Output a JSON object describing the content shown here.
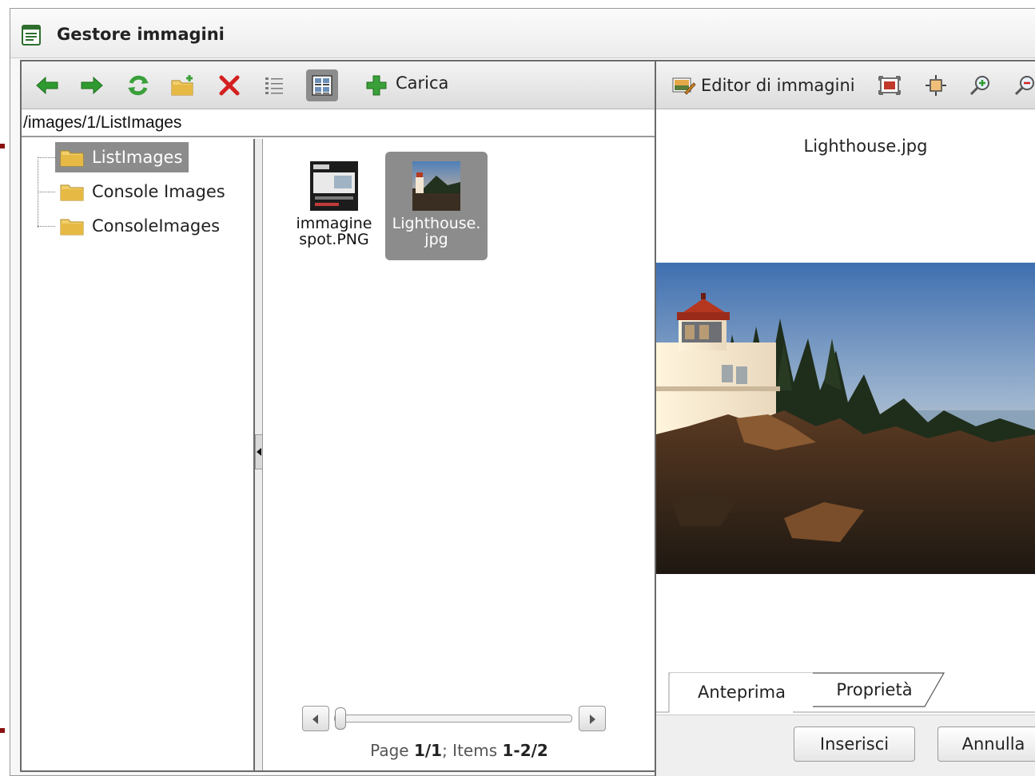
{
  "window": {
    "title": "Gestore immagini"
  },
  "explorer": {
    "toolbar": {
      "buttons": [
        {
          "name": "back",
          "icon": "arrow-left-icon",
          "color": "#2f9a2f"
        },
        {
          "name": "forward",
          "icon": "arrow-right-icon",
          "color": "#2f9a2f"
        },
        {
          "name": "refresh",
          "icon": "refresh-icon",
          "color": "#3aa03a"
        },
        {
          "name": "new-folder",
          "icon": "new-folder-icon",
          "color": "#e0b94a"
        },
        {
          "name": "delete",
          "icon": "delete-icon",
          "color": "#d42020"
        },
        {
          "name": "list-view",
          "icon": "list-view-icon",
          "active": false
        },
        {
          "name": "thumbnail-view",
          "icon": "thumbnail-view-icon",
          "active": true
        },
        {
          "name": "upload",
          "icon": "upload-icon",
          "color": "#3aa03a"
        }
      ],
      "upload_label": "Carica"
    },
    "path": "/images/1/ListImages",
    "tree": [
      {
        "label": "ListImages",
        "selected": true
      },
      {
        "label": "Console Images",
        "selected": false
      },
      {
        "label": "ConsoleImages",
        "selected": false
      }
    ],
    "files": [
      {
        "name_line1": "immagine",
        "name_line2": "spot.PNG",
        "selected": false
      },
      {
        "name_line1": "Lighthouse.",
        "name_line2": "jpg",
        "selected": true
      }
    ],
    "pager": {
      "prefix": "Page ",
      "page": "1/1",
      "middle": "; Items ",
      "items": "1-2/2"
    }
  },
  "preview": {
    "editor_label": "Editor di immagini",
    "toolbar_icons": [
      "fit-to-window-icon",
      "actual-size-icon",
      "zoom-in-icon",
      "zoom-out-icon"
    ],
    "image_title": "Lighthouse.jpg",
    "tabs": [
      {
        "label": "Anteprima",
        "active": true
      },
      {
        "label": "Proprietà",
        "active": false
      }
    ],
    "buttons": {
      "insert": "Inserisci",
      "cancel": "Annulla"
    }
  },
  "colors": {
    "selection": "#8c8c8c",
    "accent_green": "#2f9a2f",
    "delete_red": "#d42020"
  }
}
